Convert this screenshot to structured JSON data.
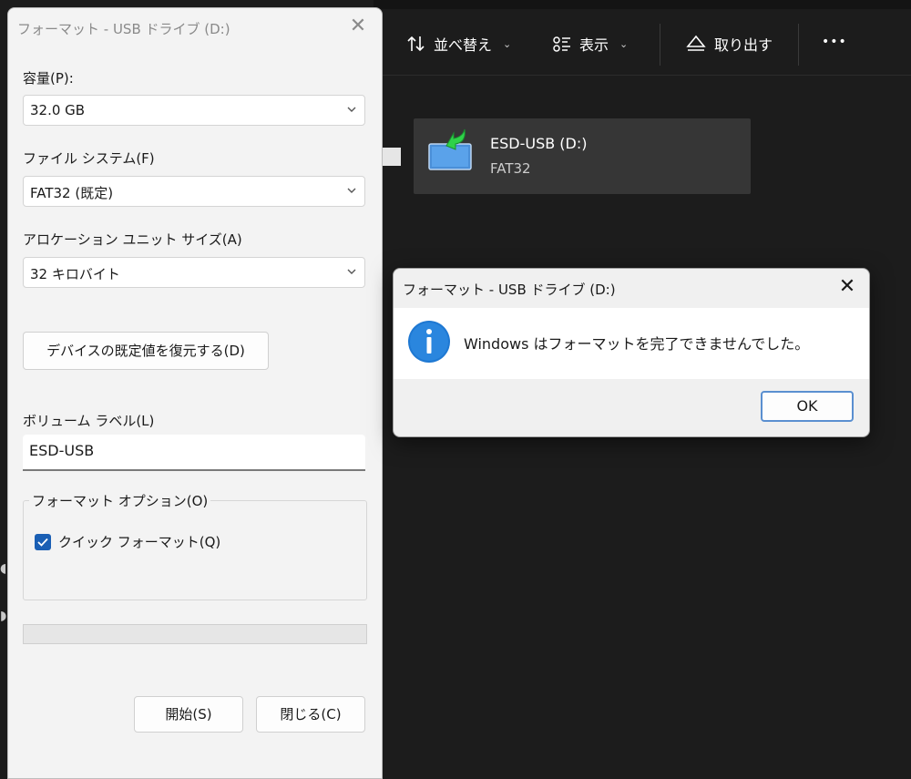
{
  "explorer": {
    "sort_label": "並べ替え",
    "view_label": "表示",
    "eject_label": "取り出す",
    "more_label": "•••",
    "drive": {
      "name": "ESD-USB (D:)",
      "filesystem": "FAT32"
    }
  },
  "format_dialog": {
    "title": "フォーマット - USB ドライブ (D:)",
    "capacity_label": "容量(P):",
    "capacity_value": "32.0 GB",
    "filesystem_label": "ファイル システム(F)",
    "filesystem_value": "FAT32 (既定)",
    "allocation_label": "アロケーション ユニット サイズ(A)",
    "allocation_value": "32 キロバイト",
    "restore_defaults_label": "デバイスの既定値を復元する(D)",
    "volume_label_label": "ボリューム ラベル(L)",
    "volume_label_value": "ESD-USB",
    "format_options_label": "フォーマット オプション(O)",
    "quick_format_label": "クイック フォーマット(Q)",
    "quick_format_checked": true,
    "progress": 0,
    "start_label": "開始(S)",
    "close_label": "閉じる(C)"
  },
  "message_box": {
    "title": "フォーマット - USB ドライブ (D:)",
    "icon": "info-icon",
    "message": "Windows はフォーマットを完了できませんでした。",
    "ok_label": "OK"
  },
  "colors": {
    "explorer_bg": "#1c1c1c",
    "dialog_bg": "#f3f3f3",
    "accent": "#1a5fb4",
    "info_icon": "#1e78d2"
  }
}
